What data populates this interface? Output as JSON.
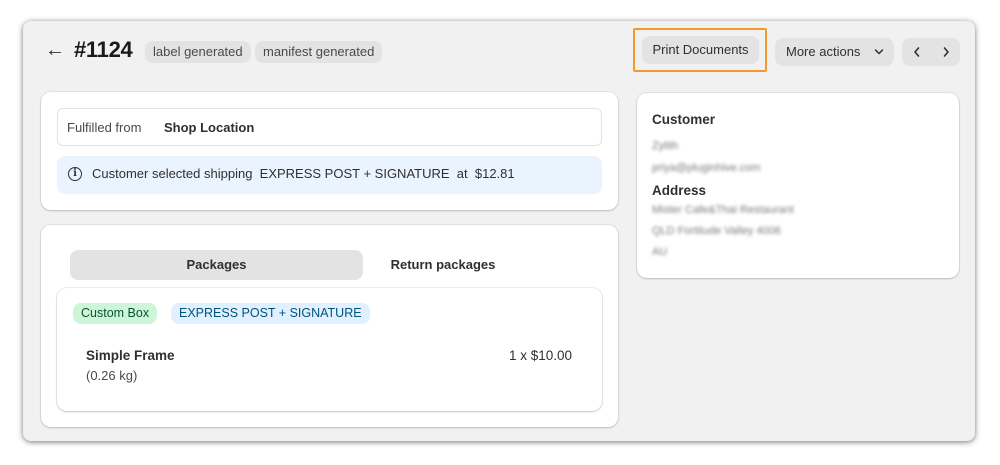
{
  "header": {
    "back_icon": "arrow-left-icon",
    "order_number": "#1124",
    "badges": [
      "label generated",
      "manifest generated"
    ],
    "print_button": "Print Documents",
    "more_actions_button": "More actions",
    "prev_icon": "chevron-left-icon",
    "next_icon": "chevron-right-icon"
  },
  "fulfillment": {
    "fulfilled_from_label": "Fulfilled from",
    "location": "Shop Location",
    "info_icon": "info-icon",
    "shipping_prefix": "Customer selected shipping",
    "shipping_service": "EXPRESS POST + SIGNATURE",
    "shipping_at": "at",
    "shipping_price": "$12.81"
  },
  "packages": {
    "tabs": [
      "Packages",
      "Return packages"
    ],
    "active_tab": "Packages",
    "box_badge": "Custom Box",
    "service_badge": "EXPRESS POST + SIGNATURE",
    "item": {
      "name": "Simple Frame",
      "weight": "(0.26 kg)",
      "quantity_price": "1 x $10.00"
    }
  },
  "customer": {
    "heading": "Customer",
    "name": "Zylith",
    "email": "priya@pluginhive.com",
    "address_heading": "Address",
    "address_line1": "Mister Cafe&Thai Restaurant",
    "address_line2": "QLD Fortitude Valley 4006",
    "country": "AU"
  },
  "colors": {
    "highlight_border": "#f29a2e",
    "info_banner_bg": "#eaf4ff",
    "box_badge_bg": "#cdf6d9",
    "service_badge_bg": "#e0f0ff"
  }
}
